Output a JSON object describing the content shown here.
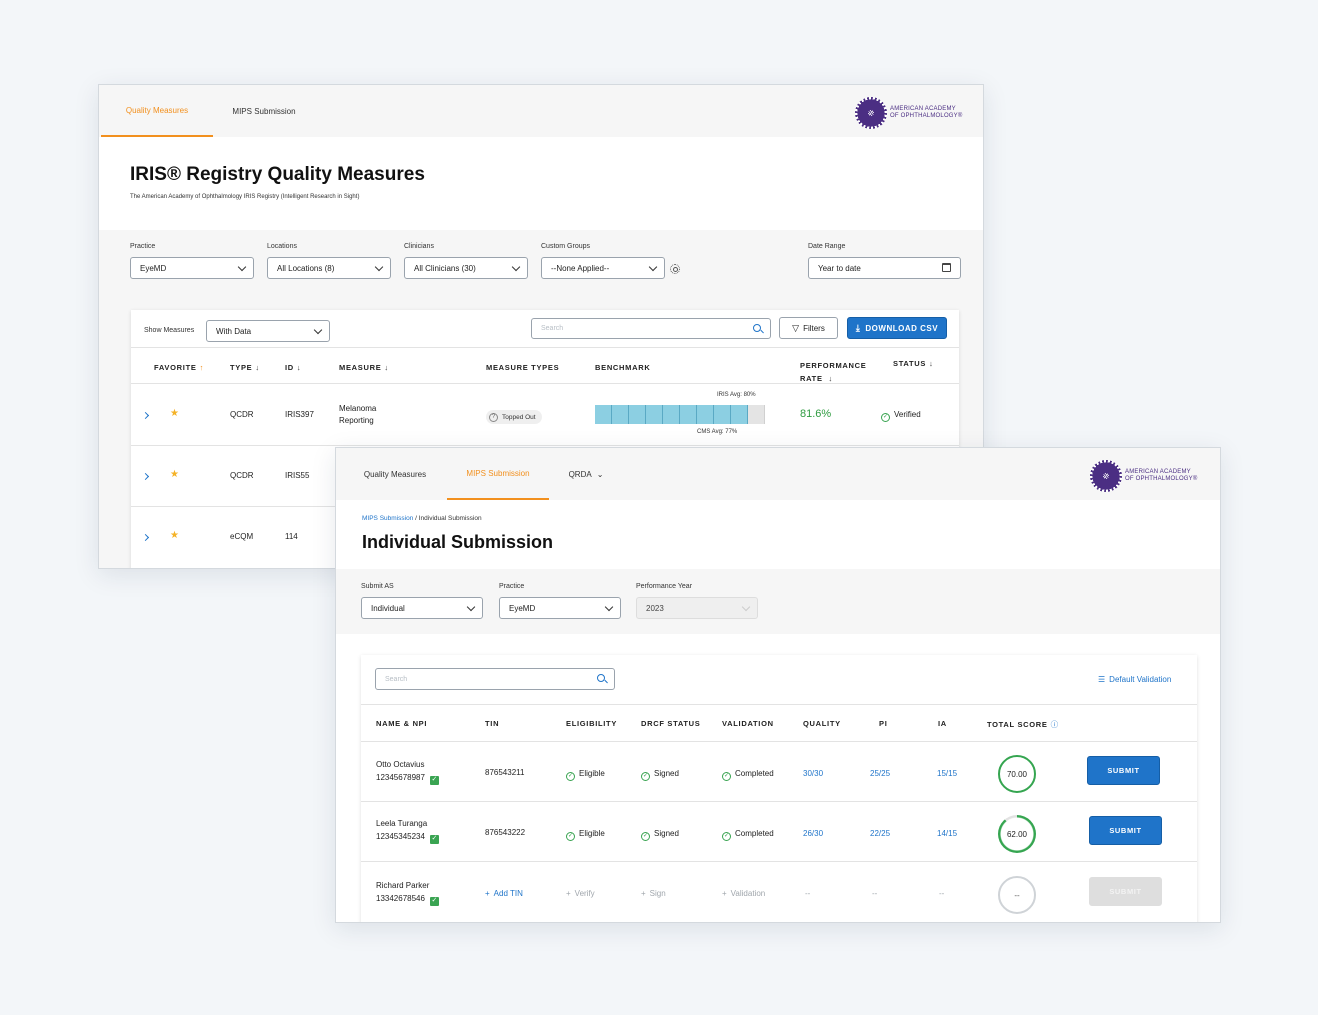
{
  "quality_window": {
    "tabs": [
      {
        "label": "Quality Measures",
        "active": true
      },
      {
        "label": "MIPS Submission",
        "active": false
      }
    ],
    "logo": {
      "line1": "AMERICAN ACADEMY",
      "line2": "OF OPHTHALMOLOGY®"
    },
    "title": "IRIS® Registry Quality Measures",
    "subtitle": "The American Academy of Ophthalmology IRIS Registry (Intelligent Research in Sight)",
    "filters": {
      "practice": {
        "label": "Practice",
        "value": "EyeMD"
      },
      "locations": {
        "label": "Locations",
        "value": "All Locations (8)"
      },
      "clinicians": {
        "label": "Clinicians",
        "value": "All Clinicians (30)"
      },
      "custom_groups": {
        "label": "Custom Groups",
        "value": "--None Applied--"
      },
      "date_range": {
        "label": "Date Range",
        "value": "Year to date"
      }
    },
    "toolbar": {
      "show_measures_label": "Show Measures",
      "show_measures_value": "With Data",
      "search_placeholder": "Search",
      "filters_label": "Filters",
      "download_label": "DOWNLOAD CSV"
    },
    "columns": {
      "favorite": "FAVORITE",
      "type": "TYPE",
      "id": "ID",
      "measure": "MEASURE",
      "measure_types": "MEASURE TYPES",
      "benchmark": "BENCHMARK",
      "performance_rate_line1": "PERFORMANCE",
      "performance_rate_line2": "RATE",
      "status": "STATUS"
    },
    "rows": [
      {
        "type": "QCDR",
        "id": "IRIS397",
        "measure_line1": "Melanoma",
        "measure_line2": "Reporting",
        "measure_type": "Topped Out",
        "iris_avg": "IRIS Avg: 80%",
        "cms_avg": "CMS Avg: 77%",
        "benchmark_filled": 9,
        "benchmark_total": 10,
        "performance_rate": "81.6%",
        "status": "Verified"
      },
      {
        "type": "QCDR",
        "id": "IRIS55"
      },
      {
        "type": "eCQM",
        "id": "114"
      }
    ]
  },
  "mips_window": {
    "tabs": [
      {
        "label": "Quality Measures",
        "active": false
      },
      {
        "label": "MIPS Submission",
        "active": true
      },
      {
        "label": "QRDA",
        "active": false
      }
    ],
    "logo": {
      "line1": "AMERICAN ACADEMY",
      "line2": "OF OPHTHALMOLOGY®"
    },
    "breadcrumb": {
      "parent": "MIPS Submission",
      "separator": " / ",
      "current": "Individual Submission"
    },
    "title": "Individual Submission",
    "filters": {
      "submit_as": {
        "label": "Submit AS",
        "value": "Individual"
      },
      "practice": {
        "label": "Practice",
        "value": "EyeMD"
      },
      "performance_year": {
        "label": "Performance Year",
        "value": "2023"
      }
    },
    "search_placeholder": "Search",
    "default_validation_label": "Default Validation",
    "columns": {
      "name_npi": "NAME & NPI",
      "tin": "TIN",
      "eligibility": "ELIGIBILITY",
      "drcf_status": "DRCF STATUS",
      "validation": "VALIDATION",
      "quality": "QUALITY",
      "pi": "PI",
      "ia": "IA",
      "total_score": "TOTAL SCORE"
    },
    "rows": [
      {
        "name": "Otto Octavius",
        "npi": "12345678987",
        "tin": "876543211",
        "eligibility": "Eligible",
        "drcf": "Signed",
        "validation": "Completed",
        "quality": "30/30",
        "pi": "25/25",
        "ia": "15/15",
        "score": "70.00",
        "score_fraction": 1.0,
        "submit": "SUBMIT"
      },
      {
        "name": "Leela Turanga",
        "npi": "12345345234",
        "tin": "876543222",
        "eligibility": "Eligible",
        "drcf": "Signed",
        "validation": "Completed",
        "quality": "26/30",
        "pi": "22/25",
        "ia": "14/15",
        "score": "62.00",
        "score_fraction": 0.89,
        "submit": "SUBMIT"
      },
      {
        "name": "Richard Parker",
        "npi": "13342678546",
        "tin": "Add TIN",
        "eligibility": "Verify",
        "drcf": "Sign",
        "validation": "Validation",
        "quality": "--",
        "pi": "--",
        "ia": "--",
        "score": "--",
        "submit": "SUBMIT"
      }
    ]
  },
  "colors": {
    "accent_orange": "#f2901e",
    "primary_blue": "#1f74c9",
    "success_green": "#35a550",
    "brand_purple": "#4b2e83"
  }
}
